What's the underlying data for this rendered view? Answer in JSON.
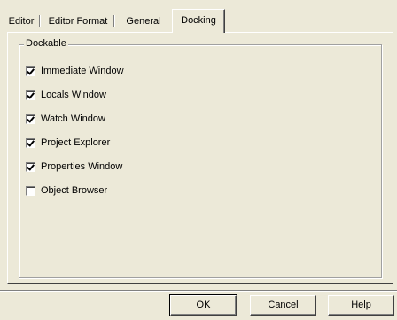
{
  "tabs": [
    {
      "label": "Editor",
      "active": false
    },
    {
      "label": "Editor Format",
      "active": false
    },
    {
      "label": "General",
      "active": false
    },
    {
      "label": "Docking",
      "active": true
    }
  ],
  "docking": {
    "group_label": "Dockable",
    "options": [
      {
        "label": "Immediate Window",
        "checked": true
      },
      {
        "label": "Locals Window",
        "checked": true
      },
      {
        "label": "Watch Window",
        "checked": true
      },
      {
        "label": "Project Explorer",
        "checked": true
      },
      {
        "label": "Properties Window",
        "checked": true
      },
      {
        "label": "Object Browser",
        "checked": false
      }
    ]
  },
  "buttons": {
    "ok": "OK",
    "cancel": "Cancel",
    "help": "Help"
  }
}
